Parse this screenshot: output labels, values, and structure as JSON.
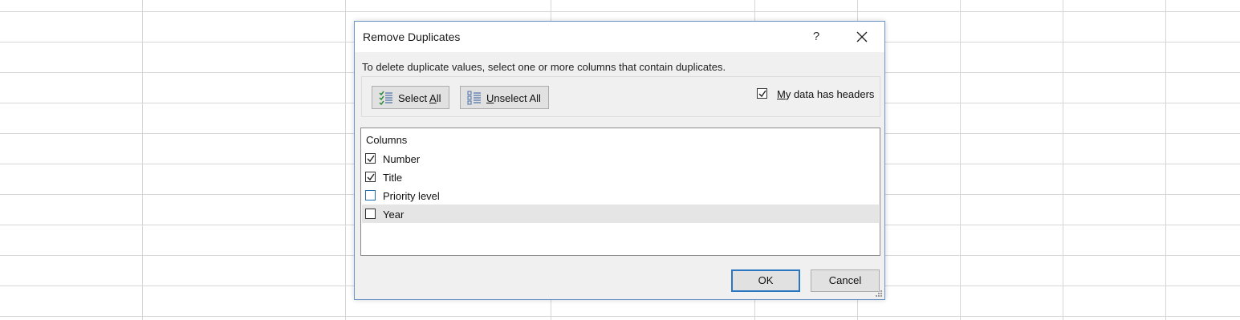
{
  "dialog": {
    "title": "Remove Duplicates",
    "help_label": "?",
    "instruction": "To delete duplicate values, select one or more columns that contain duplicates.",
    "select_all": {
      "underline": "A",
      "before": "Select ",
      "after": "ll"
    },
    "unselect_all": {
      "underline": "U",
      "before": "",
      "after": "nselect All"
    },
    "has_headers": {
      "underline": "M",
      "after": "y data has headers",
      "checked": true
    },
    "columns_header": "Columns",
    "columns": [
      {
        "label": "Number",
        "checked": true
      },
      {
        "label": "Title",
        "checked": true
      },
      {
        "label": "Priority level",
        "checked": false
      },
      {
        "label": "Year",
        "checked": false
      }
    ],
    "ok_label": "OK",
    "cancel_label": "Cancel"
  },
  "colors": {
    "dialog_border": "#6c94c8",
    "ok_focus_border": "#2a76c2",
    "selected_row": "#e5e5e5",
    "grid_line": "#d6d6d6"
  }
}
